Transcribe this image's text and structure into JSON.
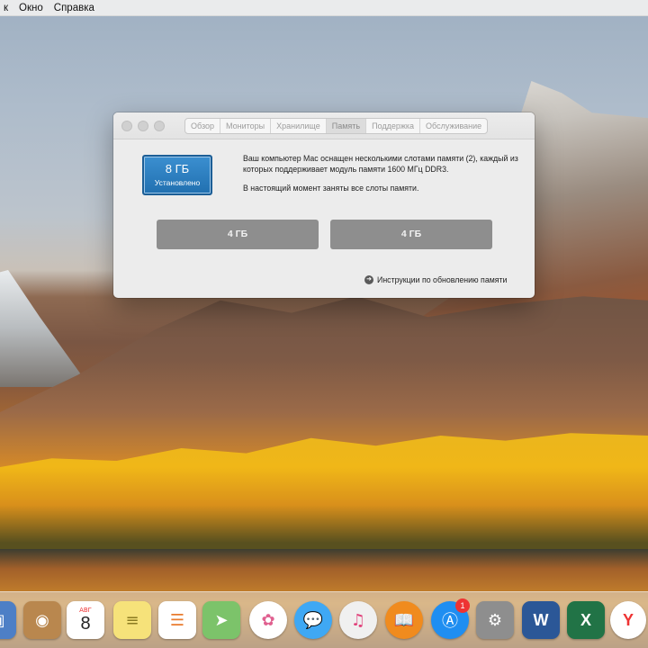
{
  "menubar": {
    "items": [
      "к",
      "Окно",
      "Справка"
    ]
  },
  "window": {
    "tabs": [
      {
        "label": "Обзор"
      },
      {
        "label": "Мониторы"
      },
      {
        "label": "Хранилище"
      },
      {
        "label": "Память"
      },
      {
        "label": "Поддержка"
      },
      {
        "label": "Обслуживание"
      }
    ],
    "active_tab": "Память",
    "memory": {
      "total": "8 ГБ",
      "status": "Установлено"
    },
    "description": {
      "line1": "Ваш компьютер Mac оснащен несколькими слотами памяти (2), каждый из которых поддерживает модуль памяти 1600 МГц DDR3.",
      "line2": "В настоящий момент заняты все слоты памяти."
    },
    "slots": [
      {
        "label": "4 ГБ"
      },
      {
        "label": "4 ГБ"
      }
    ],
    "upgrade_link": "Инструкции по обновлению памяти"
  },
  "dock": {
    "calendar": {
      "month": "АВГ",
      "day": "8"
    },
    "app_store_badge": "1",
    "items": [
      {
        "name": "preview-icon",
        "color": "#4d7fc6"
      },
      {
        "name": "contacts-icon",
        "color": "#b9874e"
      },
      {
        "name": "calendar-icon",
        "color": "#ffffff"
      },
      {
        "name": "notes-icon",
        "color": "#f6e27a"
      },
      {
        "name": "reminders-icon",
        "color": "#ffffff"
      },
      {
        "name": "maps-icon",
        "color": "#7cc36a"
      },
      {
        "name": "photos-icon",
        "color": "#ffffff"
      },
      {
        "name": "messages-icon",
        "color": "#3fa8f4"
      },
      {
        "name": "itunes-icon",
        "color": "#f0f0f0"
      },
      {
        "name": "ibooks-icon",
        "color": "#f08b1e"
      },
      {
        "name": "app-store-icon",
        "color": "#1f8ef1"
      },
      {
        "name": "system-preferences-icon",
        "color": "#8e8e8e"
      },
      {
        "name": "word-icon",
        "color": "#2b5797"
      },
      {
        "name": "excel-icon",
        "color": "#217346"
      },
      {
        "name": "yandex-browser-icon",
        "color": "#ffffff"
      }
    ]
  }
}
